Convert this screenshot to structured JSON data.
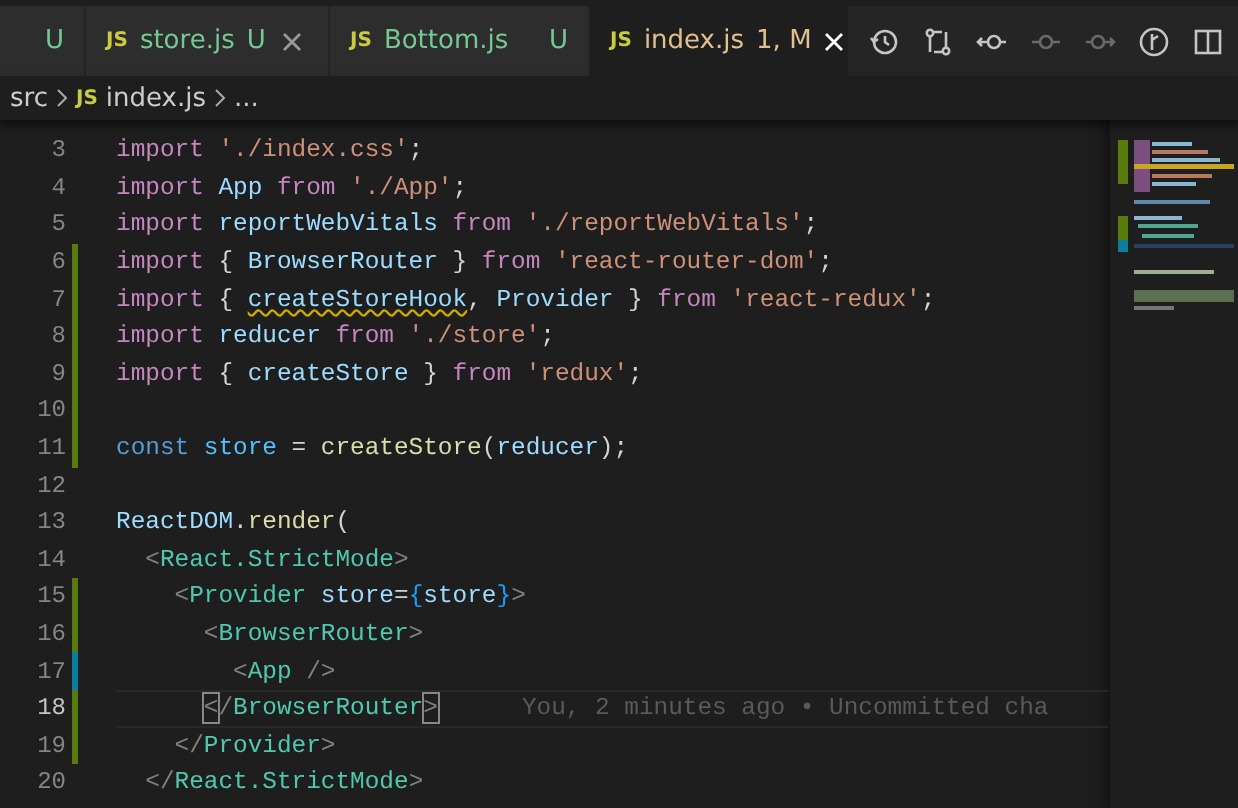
{
  "tabs": [
    {
      "status": "U",
      "color": "#73c991",
      "selected": false,
      "closable": false
    },
    {
      "icon": "JS",
      "label": "store.js",
      "status": "U",
      "color": "#73c991",
      "selected": false,
      "closable": true
    },
    {
      "icon": "JS",
      "label": "Bottom.js",
      "status": "U",
      "color": "#73c991",
      "selected": false,
      "closable": false
    },
    {
      "icon": "JS",
      "label": "index.js",
      "status": "1, M",
      "color": "#e2c08d",
      "selected": true,
      "closable": true
    }
  ],
  "breadcrumb": [
    {
      "label": "src"
    },
    {
      "icon": "JS",
      "label": "index.js"
    },
    {
      "label": "..."
    }
  ],
  "lines": [
    {
      "number": "3",
      "current": false,
      "tokens": [
        {
          "kind": "keyword",
          "text": "import "
        },
        {
          "kind": "string",
          "text": "'./index.css'"
        },
        {
          "kind": "plain",
          "text": ";"
        }
      ]
    },
    {
      "number": "4",
      "current": false,
      "tokens": [
        {
          "kind": "keyword",
          "text": "import "
        },
        {
          "kind": "variable",
          "text": "App "
        },
        {
          "kind": "keyword",
          "text": "from "
        },
        {
          "kind": "string",
          "text": "'./App'"
        },
        {
          "kind": "plain",
          "text": ";"
        }
      ]
    },
    {
      "number": "5",
      "current": false,
      "tokens": [
        {
          "kind": "keyword",
          "text": "import "
        },
        {
          "kind": "variable",
          "text": "reportWebVitals "
        },
        {
          "kind": "keyword",
          "text": "from "
        },
        {
          "kind": "string",
          "text": "'./reportWebVitals'"
        },
        {
          "kind": "plain",
          "text": ";"
        }
      ]
    },
    {
      "number": "6",
      "current": false,
      "color": "#587c0c",
      "tokens": [
        {
          "kind": "keyword",
          "text": "import "
        },
        {
          "kind": "plain",
          "text": "{ "
        },
        {
          "kind": "variable",
          "text": "BrowserRouter "
        },
        {
          "kind": "plain",
          "text": "} "
        },
        {
          "kind": "keyword",
          "text": "from "
        },
        {
          "kind": "string",
          "text": "'react-router-dom'"
        },
        {
          "kind": "plain",
          "text": ";"
        }
      ]
    },
    {
      "number": "7",
      "current": false,
      "color": "#587c0c",
      "tokens": [
        {
          "kind": "keyword",
          "text": "import "
        },
        {
          "kind": "plain",
          "text": "{ "
        },
        {
          "kind": "variable",
          "text": "createStoreHook",
          "warning": true
        },
        {
          "kind": "plain",
          "text": ", "
        },
        {
          "kind": "variable",
          "text": "Provider "
        },
        {
          "kind": "plain",
          "text": "} "
        },
        {
          "kind": "keyword",
          "text": "from "
        },
        {
          "kind": "string",
          "text": "'react-redux'"
        },
        {
          "kind": "plain",
          "text": ";"
        }
      ]
    },
    {
      "number": "8",
      "current": false,
      "color": "#587c0c",
      "tokens": [
        {
          "kind": "keyword",
          "text": "import "
        },
        {
          "kind": "variable",
          "text": "reducer "
        },
        {
          "kind": "keyword",
          "text": "from "
        },
        {
          "kind": "string",
          "text": "'./store'"
        },
        {
          "kind": "plain",
          "text": ";"
        }
      ]
    },
    {
      "number": "9",
      "current": false,
      "color": "#587c0c",
      "tokens": [
        {
          "kind": "keyword",
          "text": "import "
        },
        {
          "kind": "plain",
          "text": "{ "
        },
        {
          "kind": "variable",
          "text": "createStore "
        },
        {
          "kind": "plain",
          "text": "} "
        },
        {
          "kind": "keyword",
          "text": "from "
        },
        {
          "kind": "string",
          "text": "'redux'"
        },
        {
          "kind": "plain",
          "text": ";"
        }
      ]
    },
    {
      "number": "10",
      "current": false,
      "color": "#587c0c"
    },
    {
      "number": "11",
      "current": false,
      "color": "#587c0c",
      "tokens": [
        {
          "kind": "storage",
          "text": "const "
        },
        {
          "kind": "constant",
          "text": "store "
        },
        {
          "kind": "plain",
          "text": "= "
        },
        {
          "kind": "function",
          "text": "createStore"
        },
        {
          "kind": "plain",
          "text": "("
        },
        {
          "kind": "variable",
          "text": "reducer"
        },
        {
          "kind": "plain",
          "text": ");"
        }
      ]
    },
    {
      "number": "12",
      "current": false
    },
    {
      "number": "13",
      "current": false,
      "tokens": [
        {
          "kind": "variable",
          "text": "ReactDOM"
        },
        {
          "kind": "plain",
          "text": "."
        },
        {
          "kind": "function",
          "text": "render"
        },
        {
          "kind": "plain",
          "text": "("
        }
      ]
    },
    {
      "number": "14",
      "current": false,
      "tokens": [
        {
          "kind": "bracket",
          "text": "  <"
        },
        {
          "kind": "tag",
          "text": "React.StrictMode"
        },
        {
          "kind": "bracket",
          "text": ">"
        }
      ]
    },
    {
      "number": "15",
      "current": false,
      "color": "#587c0c",
      "tokens": [
        {
          "kind": "bracket",
          "text": "    <"
        },
        {
          "kind": "tag",
          "text": "Provider "
        },
        {
          "kind": "variable",
          "text": "store"
        },
        {
          "kind": "plain",
          "text": "="
        },
        {
          "kind": "brace",
          "text": "{"
        },
        {
          "kind": "variable",
          "text": "store"
        },
        {
          "kind": "brace",
          "text": "}"
        },
        {
          "kind": "bracket",
          "text": ">"
        }
      ]
    },
    {
      "number": "16",
      "current": false,
      "color": "#587c0c",
      "tokens": [
        {
          "kind": "bracket",
          "text": "      <"
        },
        {
          "kind": "tag",
          "text": "BrowserRouter"
        },
        {
          "kind": "bracket",
          "text": ">"
        }
      ]
    },
    {
      "number": "17",
      "current": false,
      "color": "#0c7d9d",
      "tokens": [
        {
          "kind": "bracket",
          "text": "        <"
        },
        {
          "kind": "tag",
          "text": "App "
        },
        {
          "kind": "bracket",
          "text": "/>"
        }
      ]
    },
    {
      "number": "18",
      "current": true,
      "color": "#587c0c",
      "blame": "You, 2 minutes ago • Uncommitted cha",
      "tokens": [
        {
          "kind": "bracket",
          "text": "      <",
          "match": true
        },
        {
          "kind": "bracket",
          "text": "/"
        },
        {
          "kind": "tag",
          "text": "BrowserRouter"
        },
        {
          "kind": "bracket",
          "text": ">",
          "match": true
        }
      ]
    },
    {
      "number": "19",
      "current": false,
      "color": "#587c0c",
      "tokens": [
        {
          "kind": "bracket",
          "text": "    </"
        },
        {
          "kind": "tag",
          "text": "Provider"
        },
        {
          "kind": "bracket",
          "text": ">"
        }
      ]
    },
    {
      "number": "20",
      "current": false,
      "tokens": [
        {
          "kind": "bracket",
          "text": "  </"
        },
        {
          "kind": "tag",
          "text": "React.StrictMode"
        },
        {
          "kind": "bracket",
          "text": ">"
        }
      ]
    }
  ]
}
